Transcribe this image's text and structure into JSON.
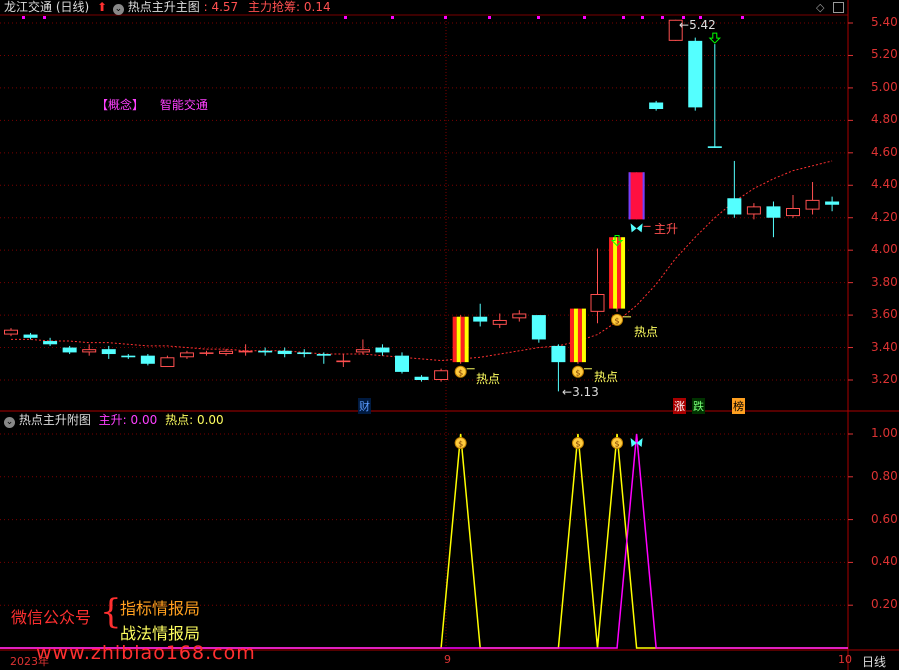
{
  "colors": {
    "background": "#000000",
    "up": "#ff5050",
    "down": "#54ffff",
    "grid": "#7a0000",
    "ma": "#ff3030",
    "yellow": "#ffff00",
    "magenta": "#ff00ff",
    "label_green": "#00ff00",
    "axis": "#d33"
  },
  "main_header": {
    "stock": "龙江交通 (日线)",
    "indicator": "热点主升主图",
    "separator": ":",
    "value": "4.57",
    "zhuli_label": "主力抢筹:",
    "zhuli_value": "0.14"
  },
  "concept": {
    "tag": "【概念】",
    "name": "智能交通"
  },
  "price_axis": [
    "5.40",
    "5.20",
    "5.00",
    "4.80",
    "4.60",
    "4.40",
    "4.20",
    "4.00",
    "3.80",
    "3.60",
    "3.40",
    "3.20"
  ],
  "annotations": {
    "high": "5.42",
    "low": "3.13",
    "hotpoint": "热点",
    "zhusheng": "主升"
  },
  "bottom_markers": {
    "cai": "财",
    "zhang": "涨",
    "die": "跌",
    "bang": "榜"
  },
  "sub_header": {
    "indicator": "热点主升附图",
    "zhusheng_label": "主升:",
    "zhusheng_value": "0.00",
    "hot_label": "热点:",
    "hot_value": "0.00"
  },
  "sub_axis": [
    "1.00",
    "0.80",
    "0.60",
    "0.40",
    "0.20"
  ],
  "watermark": {
    "label": "微信公众号",
    "line1": "指标情报局",
    "line2": "战法情报局",
    "url": "www.zhibiao168.com"
  },
  "time_axis": {
    "year": "2023年",
    "sep_label": "9",
    "end_label": "10",
    "period": "日线"
  },
  "chart_data": {
    "type": "candlestick",
    "y_range": [
      3.1,
      5.5
    ],
    "candles": [
      {
        "o": 3.48,
        "c": 3.51,
        "h": 3.52,
        "l": 3.47
      },
      {
        "o": 3.48,
        "c": 3.46,
        "h": 3.49,
        "l": 3.45
      },
      {
        "o": 3.44,
        "c": 3.42,
        "h": 3.46,
        "l": 3.41
      },
      {
        "o": 3.4,
        "c": 3.37,
        "h": 3.41,
        "l": 3.36
      },
      {
        "o": 3.37,
        "c": 3.39,
        "h": 3.42,
        "l": 3.35
      },
      {
        "o": 3.39,
        "c": 3.36,
        "h": 3.41,
        "l": 3.33
      },
      {
        "o": 3.35,
        "c": 3.34,
        "h": 3.36,
        "l": 3.33
      },
      {
        "o": 3.35,
        "c": 3.3,
        "h": 3.36,
        "l": 3.29
      },
      {
        "o": 3.28,
        "c": 3.34,
        "h": 3.35,
        "l": 3.28
      },
      {
        "o": 3.34,
        "c": 3.37,
        "h": 3.38,
        "l": 3.33
      },
      {
        "o": 3.37,
        "c": 3.37,
        "h": 3.38,
        "l": 3.35
      },
      {
        "o": 3.36,
        "c": 3.38,
        "h": 3.39,
        "l": 3.35
      },
      {
        "o": 3.37,
        "c": 3.38,
        "h": 3.42,
        "l": 3.35
      },
      {
        "o": 3.38,
        "c": 3.37,
        "h": 3.4,
        "l": 3.35
      },
      {
        "o": 3.38,
        "c": 3.36,
        "h": 3.4,
        "l": 3.34
      },
      {
        "o": 3.37,
        "c": 3.36,
        "h": 3.39,
        "l": 3.34
      },
      {
        "o": 3.36,
        "c": 3.35,
        "h": 3.37,
        "l": 3.3
      },
      {
        "o": 3.31,
        "c": 3.32,
        "h": 3.36,
        "l": 3.28
      },
      {
        "o": 3.37,
        "c": 3.39,
        "h": 3.45,
        "l": 3.36
      },
      {
        "o": 3.4,
        "c": 3.37,
        "h": 3.42,
        "l": 3.35
      },
      {
        "o": 3.35,
        "c": 3.25,
        "h": 3.37,
        "l": 3.24
      },
      {
        "o": 3.22,
        "c": 3.2,
        "h": 3.23,
        "l": 3.19
      },
      {
        "o": 3.2,
        "c": 3.26,
        "h": 3.27,
        "l": 3.19
      },
      {
        "o": 3.31,
        "c": 3.59,
        "h": 3.6,
        "l": 3.3,
        "hot": true
      },
      {
        "o": 3.59,
        "c": 3.56,
        "h": 3.67,
        "l": 3.53
      },
      {
        "o": 3.54,
        "c": 3.57,
        "h": 3.61,
        "l": 3.52
      },
      {
        "o": 3.58,
        "c": 3.61,
        "h": 3.63,
        "l": 3.56
      },
      {
        "o": 3.6,
        "c": 3.45,
        "h": 3.6,
        "l": 3.43
      },
      {
        "o": 3.41,
        "c": 3.31,
        "h": 3.42,
        "l": 3.13
      },
      {
        "o": 3.31,
        "c": 3.64,
        "h": 3.64,
        "l": 3.3,
        "hot": true
      },
      {
        "o": 3.62,
        "c": 3.73,
        "h": 4.01,
        "l": 3.55
      },
      {
        "o": 3.64,
        "c": 4.08,
        "h": 4.08,
        "l": 3.62,
        "hot": true
      },
      {
        "o": 4.19,
        "c": 4.48,
        "h": 4.48,
        "l": 4.19,
        "zhusheng": true
      },
      {
        "o": 4.91,
        "c": 4.87,
        "h": 4.92,
        "l": 4.86
      },
      {
        "o": 5.29,
        "c": 5.42,
        "h": 5.42,
        "l": 5.29
      },
      {
        "o": 5.29,
        "c": 4.88,
        "h": 5.31,
        "l": 4.86
      },
      {
        "o": 4.64,
        "c": 4.63,
        "h": 5.27,
        "l": 4.63
      },
      {
        "o": 4.32,
        "c": 4.22,
        "h": 4.55,
        "l": 4.2
      },
      {
        "o": 4.22,
        "c": 4.27,
        "h": 4.29,
        "l": 4.19
      },
      {
        "o": 4.27,
        "c": 4.2,
        "h": 4.3,
        "l": 4.08
      },
      {
        "o": 4.21,
        "c": 4.26,
        "h": 4.34,
        "l": 4.2
      },
      {
        "o": 4.25,
        "c": 4.31,
        "h": 4.42,
        "l": 4.22
      },
      {
        "o": 4.3,
        "c": 4.28,
        "h": 4.33,
        "l": 4.24
      }
    ],
    "ma": [
      3.45,
      3.45,
      3.44,
      3.44,
      3.43,
      3.43,
      3.42,
      3.41,
      3.41,
      3.4,
      3.39,
      3.39,
      3.38,
      3.38,
      3.38,
      3.37,
      3.36,
      3.36,
      3.36,
      3.35,
      3.34,
      3.33,
      3.32,
      3.33,
      3.34,
      3.36,
      3.38,
      3.4,
      3.41,
      3.44,
      3.48,
      3.56,
      3.66,
      3.79,
      3.95,
      4.08,
      4.2,
      4.3,
      4.38,
      4.44,
      4.49,
      4.52,
      4.55
    ],
    "sub_range": [
      0,
      1.05
    ],
    "hot_signal_index": [
      23,
      29,
      31
    ],
    "zhusheng_signal_index": [
      32
    ]
  }
}
